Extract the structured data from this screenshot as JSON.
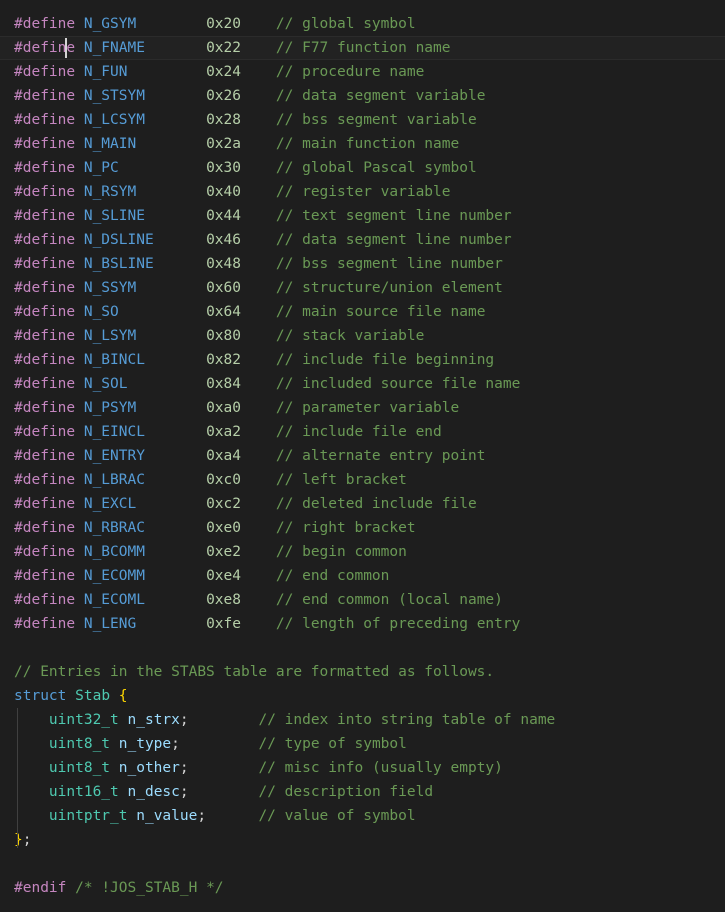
{
  "editor": {
    "language": "c-header",
    "background": "#1e1e1e",
    "foreground": "#d4d4d4",
    "current_line_background": "#222222",
    "caret_color": "#d4d4d4",
    "indent_guide_color": "#404040",
    "colors": {
      "preprocessor": "#c586c0",
      "macro_name": "#569cd6",
      "number": "#b5cea8",
      "comment": "#6a9955",
      "keyword": "#569cd6",
      "type": "#4ec9b0",
      "variable": "#9cdcfe",
      "brace": "#ffd700",
      "punctuation": "#d4d4d4"
    }
  },
  "caret": {
    "line_index": 1,
    "column": 5,
    "x": 65,
    "visible": true
  },
  "defines": [
    {
      "directive": "#define",
      "name": "N_GSYM",
      "value": "0x20",
      "comment": "// global symbol"
    },
    {
      "directive": "#define",
      "name": "N_FNAME",
      "value": "0x22",
      "comment": "// F77 function name"
    },
    {
      "directive": "#define",
      "name": "N_FUN",
      "value": "0x24",
      "comment": "// procedure name"
    },
    {
      "directive": "#define",
      "name": "N_STSYM",
      "value": "0x26",
      "comment": "// data segment variable"
    },
    {
      "directive": "#define",
      "name": "N_LCSYM",
      "value": "0x28",
      "comment": "// bss segment variable"
    },
    {
      "directive": "#define",
      "name": "N_MAIN",
      "value": "0x2a",
      "comment": "// main function name"
    },
    {
      "directive": "#define",
      "name": "N_PC",
      "value": "0x30",
      "comment": "// global Pascal symbol"
    },
    {
      "directive": "#define",
      "name": "N_RSYM",
      "value": "0x40",
      "comment": "// register variable"
    },
    {
      "directive": "#define",
      "name": "N_SLINE",
      "value": "0x44",
      "comment": "// text segment line number"
    },
    {
      "directive": "#define",
      "name": "N_DSLINE",
      "value": "0x46",
      "comment": "// data segment line number"
    },
    {
      "directive": "#define",
      "name": "N_BSLINE",
      "value": "0x48",
      "comment": "// bss segment line number"
    },
    {
      "directive": "#define",
      "name": "N_SSYM",
      "value": "0x60",
      "comment": "// structure/union element"
    },
    {
      "directive": "#define",
      "name": "N_SO",
      "value": "0x64",
      "comment": "// main source file name"
    },
    {
      "directive": "#define",
      "name": "N_LSYM",
      "value": "0x80",
      "comment": "// stack variable"
    },
    {
      "directive": "#define",
      "name": "N_BINCL",
      "value": "0x82",
      "comment": "// include file beginning"
    },
    {
      "directive": "#define",
      "name": "N_SOL",
      "value": "0x84",
      "comment": "// included source file name"
    },
    {
      "directive": "#define",
      "name": "N_PSYM",
      "value": "0xa0",
      "comment": "// parameter variable"
    },
    {
      "directive": "#define",
      "name": "N_EINCL",
      "value": "0xa2",
      "comment": "// include file end"
    },
    {
      "directive": "#define",
      "name": "N_ENTRY",
      "value": "0xa4",
      "comment": "// alternate entry point"
    },
    {
      "directive": "#define",
      "name": "N_LBRAC",
      "value": "0xc0",
      "comment": "// left bracket"
    },
    {
      "directive": "#define",
      "name": "N_EXCL",
      "value": "0xc2",
      "comment": "// deleted include file"
    },
    {
      "directive": "#define",
      "name": "N_RBRAC",
      "value": "0xe0",
      "comment": "// right bracket"
    },
    {
      "directive": "#define",
      "name": "N_BCOMM",
      "value": "0xe2",
      "comment": "// begin common"
    },
    {
      "directive": "#define",
      "name": "N_ECOMM",
      "value": "0xe4",
      "comment": "// end common"
    },
    {
      "directive": "#define",
      "name": "N_ECOML",
      "value": "0xe8",
      "comment": "// end common (local name)"
    },
    {
      "directive": "#define",
      "name": "N_LENG",
      "value": "0xfe",
      "comment": "// length of preceding entry"
    }
  ],
  "struct_section": {
    "lead_comment": "// Entries in the STABS table are formatted as follows.",
    "keyword": "struct",
    "tag": "Stab",
    "open_brace": "{",
    "close": "};",
    "fields": [
      {
        "type": "uint32_t",
        "name": "n_strx",
        "terminator": ";",
        "comment": "// index into string table of name"
      },
      {
        "type": "uint8_t",
        "name": "n_type",
        "terminator": ";",
        "comment": "// type of symbol"
      },
      {
        "type": "uint8_t",
        "name": "n_other",
        "terminator": ";",
        "comment": "// misc info (usually empty)"
      },
      {
        "type": "uint16_t",
        "name": "n_desc",
        "terminator": ";",
        "comment": "// description field"
      },
      {
        "type": "uintptr_t",
        "name": "n_value",
        "terminator": ";",
        "comment": "// value of symbol"
      }
    ]
  },
  "footer": {
    "endif": "#endif",
    "endif_comment": "/* !JOS_STAB_H */"
  }
}
